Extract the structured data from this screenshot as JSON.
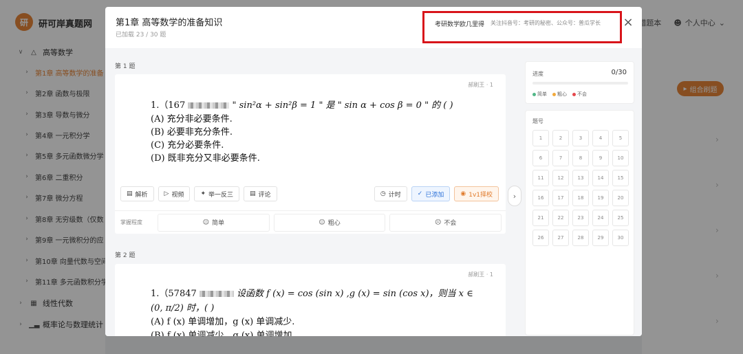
{
  "app": {
    "brand": "研可岸真题网",
    "logo_text": "研",
    "nav_right": [
      "错题本",
      "个人中心"
    ]
  },
  "sidebar": {
    "groups": [
      {
        "label": "高等数学",
        "icon": "warning-triangle-icon",
        "expanded": true,
        "items": [
          "第1章 高等数学的准备",
          "第2章 函数与极限",
          "第3章 导数与微分",
          "第4章 一元积分学",
          "第5章 多元函数微分学",
          "第6章 二重积分",
          "第7章 微分方程",
          "第8章 无穷级数（仅数",
          "第9章 一元微积分的应",
          "第10章 向量代数与空间",
          "第11章 多元函数积分学"
        ]
      },
      {
        "label": "线性代数",
        "icon": "grid-icon"
      },
      {
        "label": "概率论与数理统计",
        "icon": "bar-chart-icon"
      }
    ]
  },
  "background": {
    "combine_button": "组合刷题"
  },
  "modal": {
    "title": "第1章 高等数学的准备知识",
    "subtitle": "已加载 23 / 30 题",
    "author": "考研数学欧几里得",
    "follow": "关注抖音号：考研的秘密、公众号：普瓜学长",
    "close": "×"
  },
  "q1": {
    "label": "第 1 题",
    "source": "郝刷王 · 1",
    "stem_prefix": "1.（167",
    "stem_math": "\" sin²α + sin²β = 1 \" 是 \" sin α + cos β = 0 \" 的 (      )",
    "options": [
      "(A) 充分非必要条件.",
      "(B) 必要非充分条件.",
      "(C) 充分必要条件.",
      "(D) 既非充分又非必要条件."
    ],
    "tools": [
      "解析",
      "视频",
      "举一反三",
      "评论"
    ],
    "tools_right": [
      "计时",
      "已添加",
      "1v1择校"
    ],
    "mastery_label": "掌握程度",
    "mastery": [
      "简单",
      "粗心",
      "不会"
    ]
  },
  "q2": {
    "label": "第 2 题",
    "source": "郝刷王 · 1",
    "stem_prefix": "1.（57847",
    "stem_text": "设函数 f (x) = cos (sin x) ,g (x) = sin (cos x)，则当 x ∈",
    "stem_line2": "(0, π/2) 时，(      )",
    "options": [
      "(A) f (x) 单调增加，g (x) 单调减少.",
      "(B) f (x) 单调减少，g (x) 单调增加."
    ]
  },
  "progress": {
    "title": "进度",
    "value": "0/30",
    "fraction": 0,
    "legend": [
      {
        "label": "简单",
        "color": "#52b788"
      },
      {
        "label": "粗心",
        "color": "#f2a93b"
      },
      {
        "label": "不会",
        "color": "#e5484d"
      }
    ]
  },
  "numbers": {
    "title": "题号",
    "items": [
      "1",
      "2",
      "3",
      "4",
      "5",
      "6",
      "7",
      "8",
      "9",
      "10",
      "11",
      "12",
      "13",
      "14",
      "15",
      "16",
      "17",
      "18",
      "19",
      "20",
      "21",
      "22",
      "23",
      "24",
      "25",
      "26",
      "27",
      "28",
      "29",
      "30"
    ]
  }
}
